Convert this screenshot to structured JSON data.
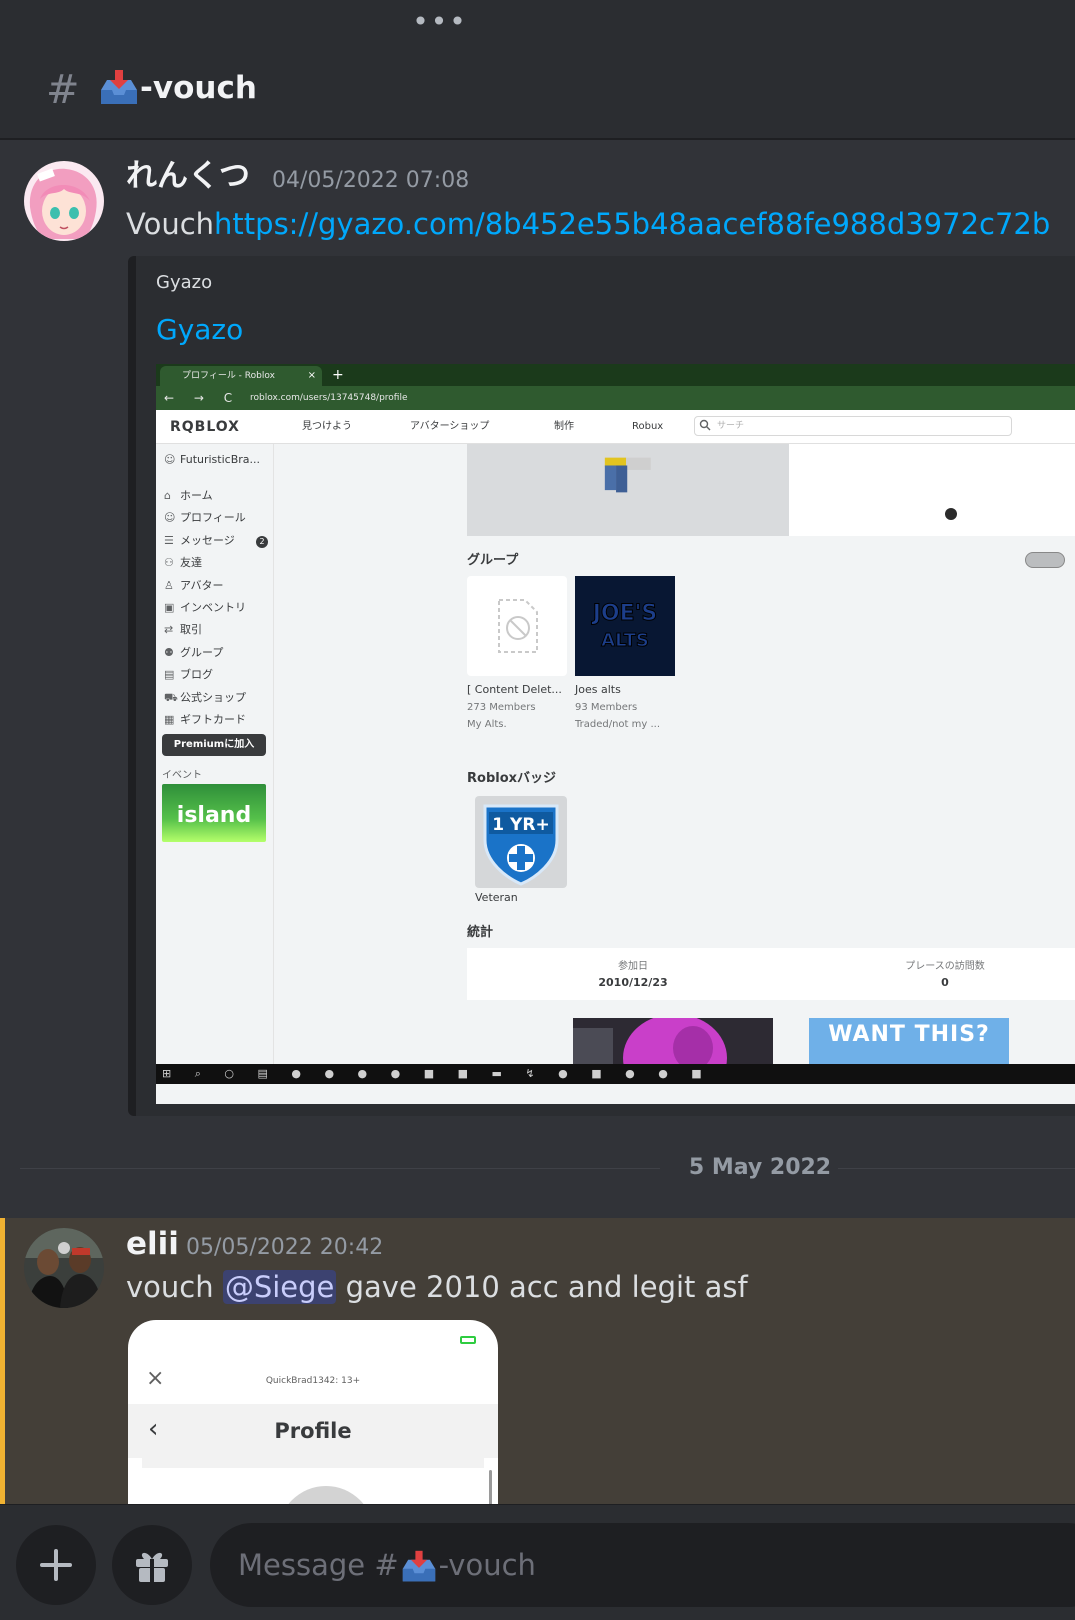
{
  "header": {
    "more_glyph": "•••",
    "hash_glyph": "#",
    "channel_name": "-vouch",
    "channel_emoji": "inbox-tray-emoji"
  },
  "message1": {
    "username": "れんくつ",
    "timestamp": "04/05/2022 07:08",
    "text_prefix": "Vouch",
    "link": "https://gyazo.com/8b452e55b48aacef88fe988d3972c72b",
    "embed": {
      "provider": "Gyazo",
      "title": "Gyazo",
      "screenshot": {
        "tab_title": "プロフィール - Roblox",
        "tab_close": "×",
        "tab_plus": "+",
        "nav_icons": "← → C",
        "url": "roblox.com/users/13745748/profile",
        "logo": "RQBLOX",
        "nav": [
          "見つけよう",
          "アバターショップ",
          "制作",
          "Robux"
        ],
        "search_placeholder": "サーチ",
        "sidebar_user": "FuturisticBra...",
        "sidebar_items": [
          {
            "icon": "⌂",
            "label": "ホーム"
          },
          {
            "icon": "☺",
            "label": "プロフィール"
          },
          {
            "icon": "☰",
            "label": "メッセージ"
          },
          {
            "icon": "⚇",
            "label": "友達"
          },
          {
            "icon": "♙",
            "label": "アバター"
          },
          {
            "icon": "▣",
            "label": "インベントリ"
          },
          {
            "icon": "⇄",
            "label": "取引"
          },
          {
            "icon": "⚉",
            "label": "グループ"
          },
          {
            "icon": "▤",
            "label": "ブログ"
          },
          {
            "icon": "⛟",
            "label": "公式ショップ"
          },
          {
            "icon": "▦",
            "label": "ギフトカード"
          }
        ],
        "messages_badge": "2",
        "premium_button": "Premiumに加入",
        "event_label": "イベント",
        "event_banner": "island",
        "groups_title": "グループ",
        "groups": [
          {
            "name": "[ Content Delet...",
            "members": "273 Members",
            "desc": "My Alts."
          },
          {
            "name": "Joes alts",
            "members": "93 Members",
            "desc": "Traded/not my ..."
          }
        ],
        "badges_title": "Robloxバッジ",
        "badge_name": "Veteran",
        "badge_text": "1 YR+",
        "stats_title": "統計",
        "stats": [
          {
            "label": "参加日",
            "value": "2010/12/23"
          },
          {
            "label": "プレースの訪問数",
            "value": "0"
          }
        ],
        "thumb_text": "WANT THIS?",
        "group_logo_text": [
          "JOE'S",
          "ALTS"
        ]
      }
    }
  },
  "date_divider": "5 May 2022",
  "message2": {
    "username": "elii",
    "timestamp": "05/05/2022 20:42",
    "text_prefix": "vouch ",
    "mention": "@Siege",
    "text_suffix": " gave 2010 acc and legit asf",
    "attachment": {
      "top_title": "QuickBrad1342: 13+",
      "close_glyph": "×",
      "back_glyph": "‹",
      "heading": "Profile"
    }
  },
  "composer": {
    "placeholder_prefix": "Message #",
    "placeholder_suffix": "-vouch",
    "plus_button": "add-attachment",
    "gift_button": "gift"
  },
  "colors": {
    "bg": "#313338",
    "link": "#00a8fc",
    "highlight_bar": "#f0b232",
    "highlight_bg": "#443f38"
  }
}
